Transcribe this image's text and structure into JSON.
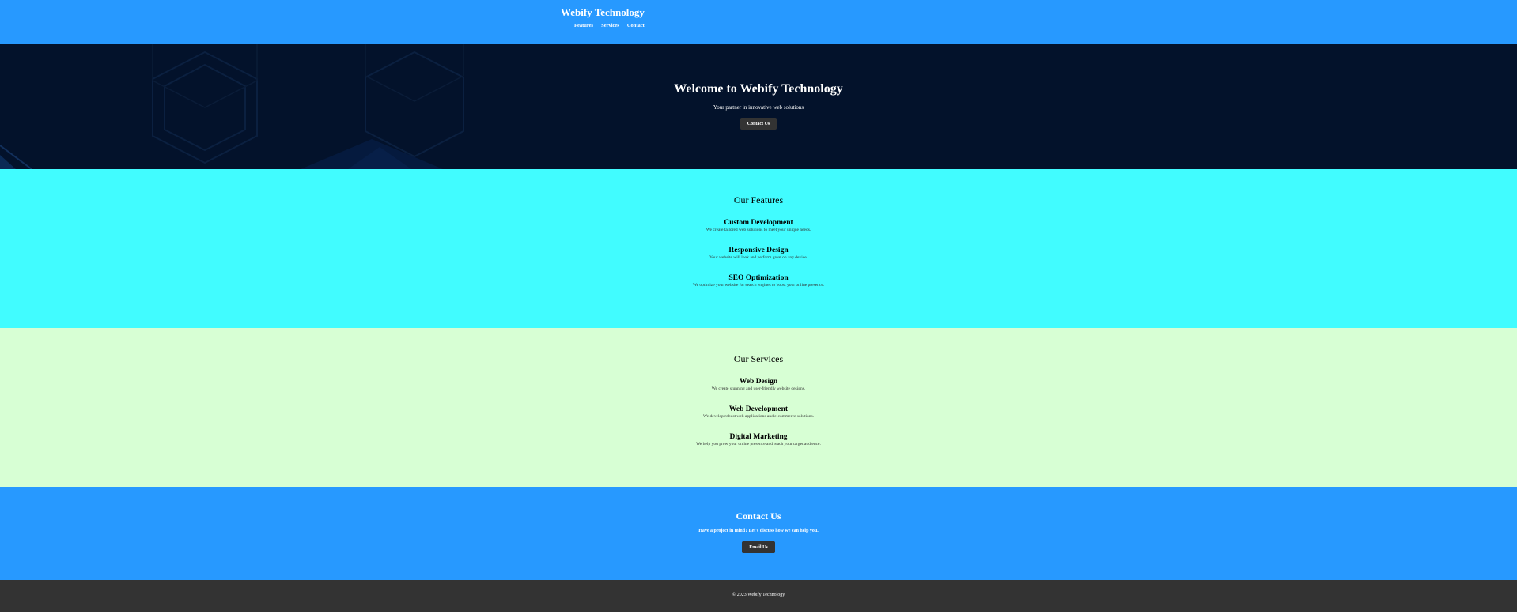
{
  "header": {
    "brand": "Webify Technology",
    "nav": [
      {
        "label": "Features"
      },
      {
        "label": "Services"
      },
      {
        "label": "Contact"
      }
    ]
  },
  "hero": {
    "title": "Welcome to Webify Technology",
    "subtitle": "Your partner in innovative web solutions",
    "button_label": "Contact Us"
  },
  "features": {
    "title": "Our Features",
    "items": [
      {
        "title": "Custom Development",
        "description": "We create tailored web solutions to meet your unique needs."
      },
      {
        "title": "Responsive Design",
        "description": "Your website will look and perform great on any device."
      },
      {
        "title": "SEO Optimization",
        "description": "We optimize your website for search engines to boost your online presence."
      }
    ]
  },
  "services": {
    "title": "Our Services",
    "items": [
      {
        "title": "Web Design",
        "description": "We create stunning and user-friendly website designs."
      },
      {
        "title": "Web Development",
        "description": "We develop robust web applications and e-commerce solutions."
      },
      {
        "title": "Digital Marketing",
        "description": "We help you grow your online presence and reach your target audience."
      }
    ]
  },
  "contact": {
    "title": "Contact Us",
    "text": "Have a project in mind? Let's discuss how we can help you.",
    "button_label": "Email Us"
  },
  "footer": {
    "copyright": "© 2023 Webify Technology"
  },
  "colors": {
    "header_bg": "#2799ff",
    "hero_bg": "#03122b",
    "features_bg": "#41fcff",
    "services_bg": "#d7ffd4",
    "contact_bg": "#2799ff",
    "footer_bg": "#333333",
    "button_bg": "#333333"
  }
}
